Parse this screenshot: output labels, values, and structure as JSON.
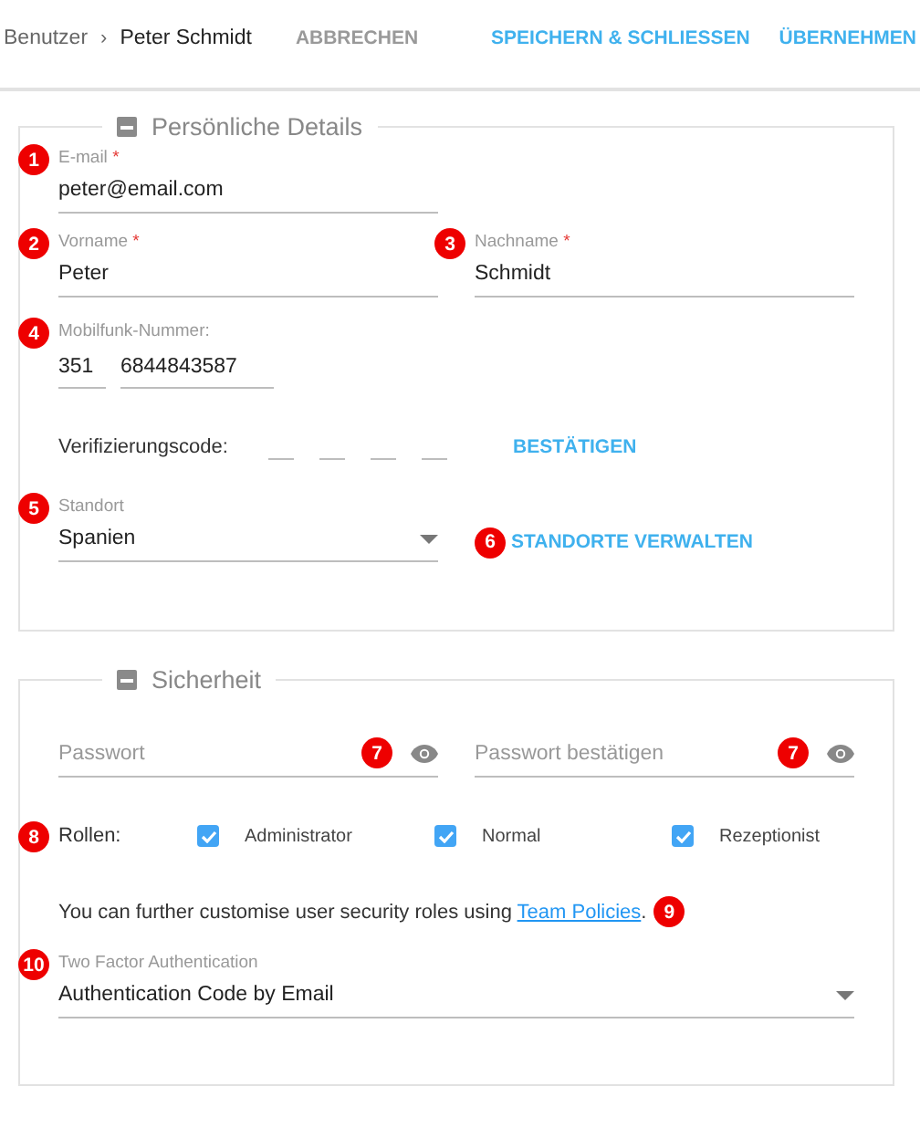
{
  "breadcrumb": {
    "parent": "Benutzer",
    "separator": "›",
    "current": "Peter Schmidt"
  },
  "actions": [
    {
      "label": "ABBRECHEN",
      "kind": "secondary"
    },
    {
      "label": "SPEICHERN & SCHLIESSEN",
      "kind": "primary"
    },
    {
      "label": "ÜBERNEHMEN",
      "kind": "primary"
    }
  ],
  "personal": {
    "title": "Persönliche Details",
    "email": {
      "marker": "1",
      "label": "E-mail",
      "required_mark": "*",
      "value": "peter@email.com"
    },
    "first_name": {
      "marker": "2",
      "label": "Vorname",
      "required_mark": "*",
      "value": "Peter"
    },
    "last_name": {
      "marker": "3",
      "label": "Nachname",
      "required_mark": "*",
      "value": "Schmidt"
    },
    "mobile": {
      "marker": "4",
      "label": "Mobilfunk-Nummer:",
      "country_code": "351",
      "number": "6844843587"
    },
    "verification": {
      "label": "Verifizierungscode:",
      "button": "BESTÄTIGEN"
    },
    "location": {
      "marker": "5",
      "label": "Standort",
      "value": "Spanien",
      "manage_marker": "6",
      "manage_link": "STANDORTE VERWALTEN"
    }
  },
  "security": {
    "title": "Sicherheit",
    "password": {
      "placeholder": "Passwort",
      "marker": "7"
    },
    "confirm_password": {
      "placeholder": "Passwort bestätigen",
      "marker": "7"
    },
    "roles": {
      "marker": "8",
      "label": "Rollen:",
      "items": [
        {
          "label": "Administrator",
          "checked": true
        },
        {
          "label": "Normal",
          "checked": true
        },
        {
          "label": "Rezeptionist",
          "checked": true
        }
      ]
    },
    "note": {
      "text": "You can further customise user security roles using ",
      "link": "Team Policies",
      "end": ".",
      "marker": "9"
    },
    "two_factor": {
      "marker": "10",
      "label": "Two Factor Authentication",
      "value": "Authentication Code by Email"
    }
  }
}
